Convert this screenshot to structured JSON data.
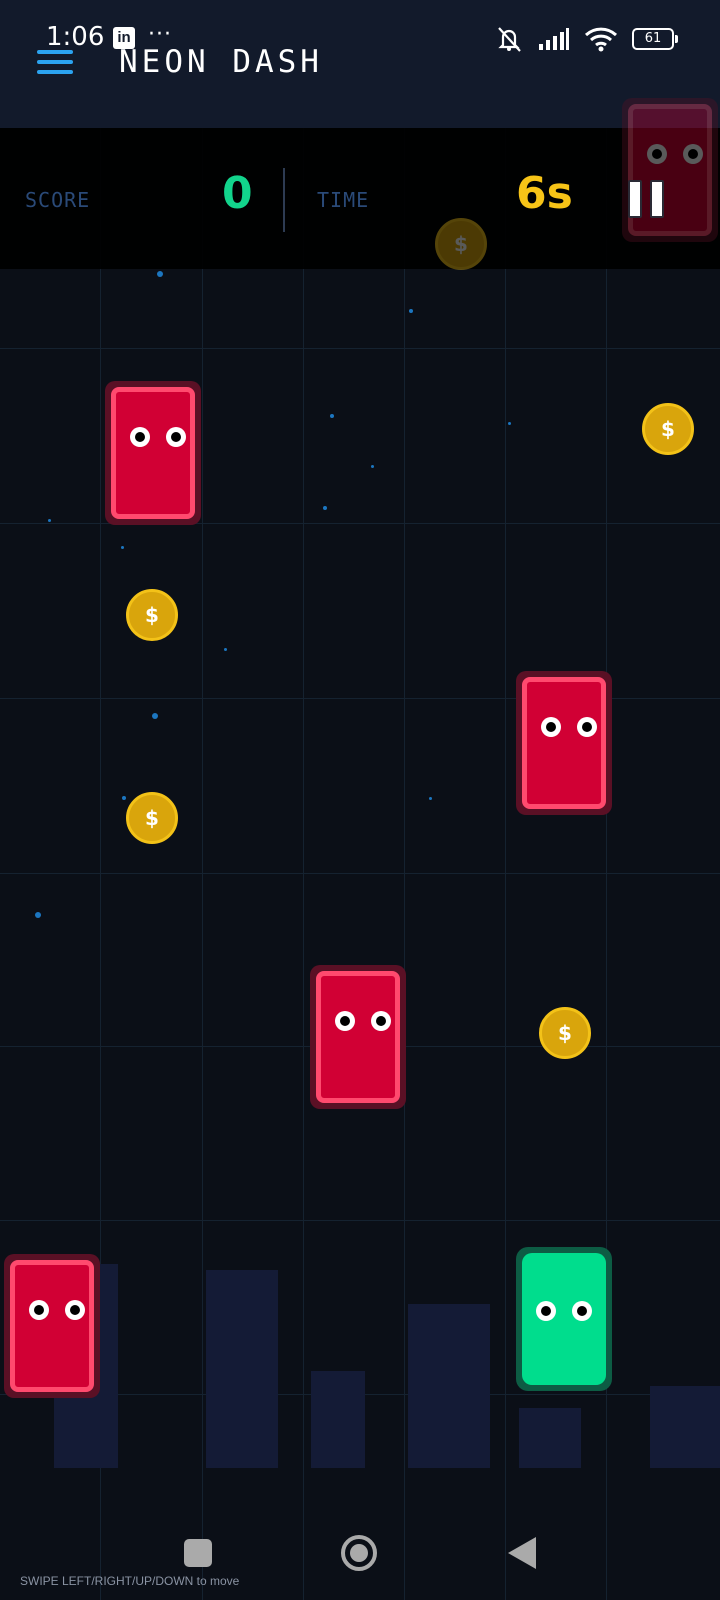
{
  "status_bar": {
    "time": "1:06",
    "notification_icon": "linkedin-icon",
    "linkedin_glyph": "in",
    "more_indicator": "···",
    "battery_level": "61"
  },
  "header": {
    "title": "NEON DASH",
    "menu_icon": "hamburger-menu-icon"
  },
  "hud": {
    "score_label": "SCORE",
    "score_value": "0",
    "time_label": "TIME",
    "time_value": "6s",
    "pause_icon": "pause-icon"
  },
  "coin_symbol": "$",
  "colors": {
    "score": "#12d48c",
    "time": "#f7c417",
    "enemy": "#d10034",
    "player": "#00dd8d",
    "coin": "#d9a50c",
    "accent": "#2ba3f0"
  },
  "hint": "SWIPE LEFT/RIGHT/UP/DOWN to move"
}
